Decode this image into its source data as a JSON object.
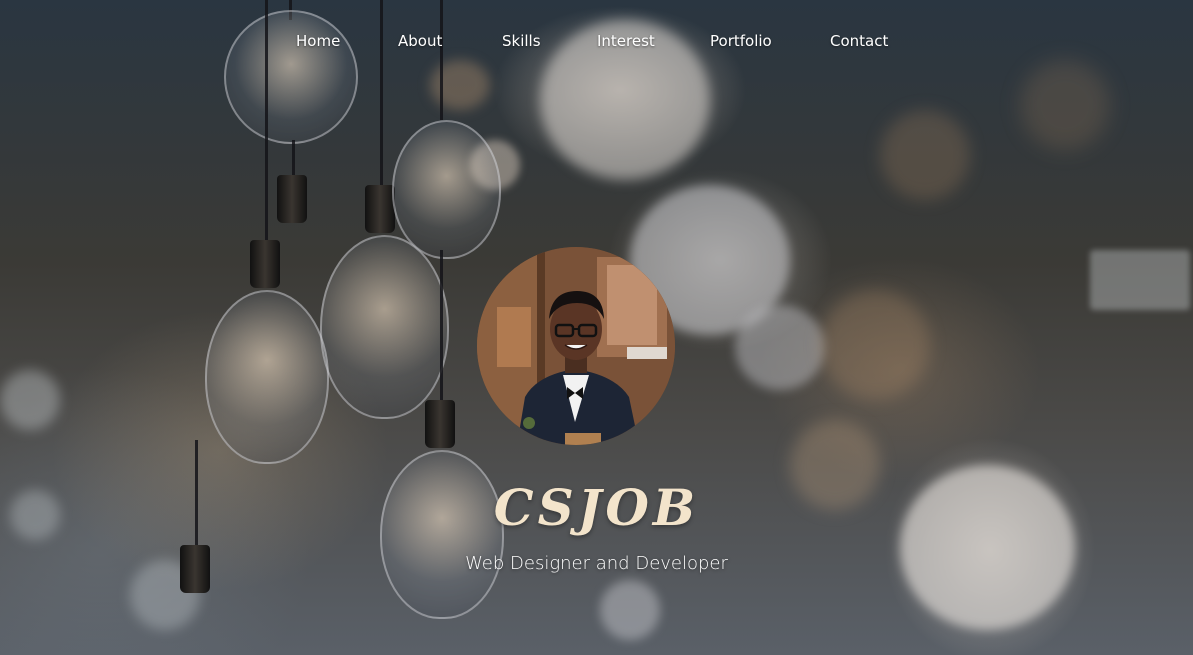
{
  "nav": {
    "items": [
      {
        "label": "Home"
      },
      {
        "label": "About"
      },
      {
        "label": "Skills"
      },
      {
        "label": "Interest"
      },
      {
        "label": "Portfolio"
      },
      {
        "label": "Contact"
      }
    ]
  },
  "hero": {
    "brand": "CSJOB",
    "tagline": "Web Designer and Developer",
    "avatar_icon": "profile-photo"
  },
  "colors": {
    "brand_text": "#f3e4cb",
    "nav_text": "#ffffff",
    "background_dark": "#2a3641"
  }
}
